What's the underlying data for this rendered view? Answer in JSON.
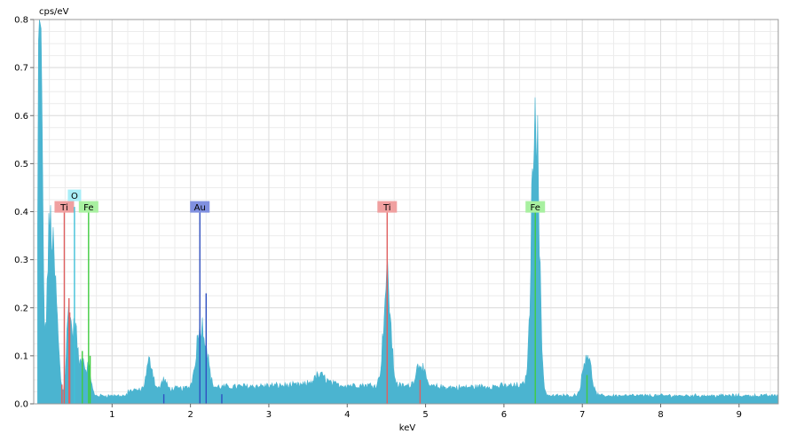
{
  "chart_data": {
    "type": "area",
    "title": "",
    "xlabel": "keV",
    "ylabel": "cps/eV",
    "xlim": [
      0,
      9.5
    ],
    "ylim": [
      0,
      0.8
    ],
    "x_ticks": [
      "1",
      "2",
      "3",
      "4",
      "5",
      "6",
      "7",
      "8",
      "9"
    ],
    "y_ticks": [
      "0.0",
      "0.1",
      "0.2",
      "0.3",
      "0.4",
      "0.5",
      "0.6",
      "0.7",
      "0.8"
    ],
    "grid": true,
    "colors": {
      "spectrum": "#4bb4d0",
      "grid": "#dddddd",
      "Ti": "#e06060",
      "O": "#40c0d8",
      "Fe": "#40cc40",
      "Au": "#3050c0"
    },
    "background_level": 0.015,
    "peaks": [
      {
        "x": 0.07,
        "y": 0.75,
        "w": 0.015
      },
      {
        "x": 0.1,
        "y": 0.52,
        "w": 0.02
      },
      {
        "x": 0.2,
        "y": 0.3,
        "w": 0.035
      },
      {
        "x": 0.27,
        "y": 0.21,
        "w": 0.04
      },
      {
        "x": 0.45,
        "y": 0.18,
        "w": 0.03
      },
      {
        "x": 0.53,
        "y": 0.14,
        "w": 0.03
      },
      {
        "x": 0.62,
        "y": 0.08,
        "w": 0.03
      },
      {
        "x": 0.7,
        "y": 0.06,
        "w": 0.03
      },
      {
        "x": 1.48,
        "y": 0.06,
        "w": 0.04
      },
      {
        "x": 1.66,
        "y": 0.02,
        "w": 0.03
      },
      {
        "x": 2.12,
        "y": 0.12,
        "w": 0.05
      },
      {
        "x": 2.2,
        "y": 0.06,
        "w": 0.04
      },
      {
        "x": 3.65,
        "y": 0.02,
        "w": 0.08
      },
      {
        "x": 4.51,
        "y": 0.22,
        "w": 0.045
      },
      {
        "x": 4.93,
        "y": 0.05,
        "w": 0.05
      },
      {
        "x": 6.4,
        "y": 0.63,
        "w": 0.045
      },
      {
        "x": 7.06,
        "y": 0.09,
        "w": 0.05
      }
    ],
    "markers": [
      {
        "element": "Ti",
        "lines": [
          {
            "x": 0.39,
            "y": 0.225,
            "tag": true
          },
          {
            "x": 0.45,
            "y": 0.22
          },
          {
            "x": 0.46,
            "y": 0.19
          },
          {
            "x": 0.36,
            "y": 0.04
          }
        ]
      },
      {
        "element": "O",
        "lines": [
          {
            "x": 0.52,
            "y": 0.44,
            "tag": true
          }
        ]
      },
      {
        "element": "Fe",
        "lines": [
          {
            "x": 0.7,
            "y": 0.1,
            "tag": true
          },
          {
            "x": 0.62,
            "y": 0.11
          },
          {
            "x": 0.72,
            "y": 0.1
          }
        ]
      },
      {
        "element": "Au",
        "lines": [
          {
            "x": 2.12,
            "y": 0.12,
            "tag": true
          },
          {
            "x": 2.2,
            "y": 0.23
          },
          {
            "x": 1.66,
            "y": 0.02
          },
          {
            "x": 2.4,
            "y": 0.02
          }
        ]
      },
      {
        "element": "Ti",
        "lines": [
          {
            "x": 4.51,
            "y": 0.24,
            "tag": true
          },
          {
            "x": 4.93,
            "y": 0.05
          }
        ]
      },
      {
        "element": "Fe",
        "lines": [
          {
            "x": 6.4,
            "y": 0.63,
            "tag": true
          },
          {
            "x": 7.06,
            "y": 0.06
          }
        ]
      }
    ]
  }
}
